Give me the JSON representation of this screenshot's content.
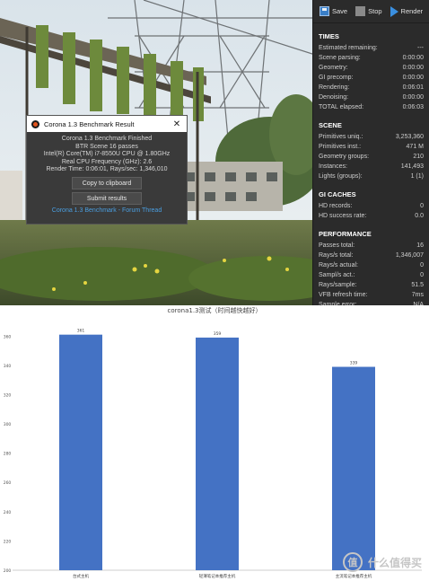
{
  "dialog": {
    "title": "Corona 1.3 Benchmark Result",
    "close_glyph": "✕",
    "lines": [
      "Corona 1.3 Benchmark Finished",
      "BTR Scene 16 passes",
      "Intel(R) Core(TM) i7-8550U CPU @ 1.80GHz",
      "Real CPU Frequency (GHz): 2.6",
      "Render Time: 0:06:01, Rays/sec: 1,346,010"
    ],
    "copy_button": "Copy to clipboard",
    "submit_button": "Submit results",
    "link": "Corona 1.3 Benchmark - Forum Thread"
  },
  "panel": {
    "toolbar": {
      "save": "Save",
      "stop": "Stop",
      "render": "Render"
    },
    "sections": [
      {
        "title": "TIMES",
        "rows": [
          [
            "Estimated remaining:",
            "---"
          ],
          [
            "Scene parsing:",
            "0:00:00"
          ],
          [
            "Geometry:",
            "0:00:00"
          ],
          [
            "GI precomp:",
            "0:00:00"
          ],
          [
            "Rendering:",
            "0:06:01"
          ],
          [
            "Denoising:",
            "0:00:00"
          ],
          [
            "TOTAL elapsed:",
            "0:06:03"
          ]
        ]
      },
      {
        "title": "SCENE",
        "rows": [
          [
            "Primitives uniq.:",
            "3,253,360"
          ],
          [
            "Primitives inst.:",
            "471 M"
          ],
          [
            "Geometry groups:",
            "210"
          ],
          [
            "Instances:",
            "141,493"
          ],
          [
            "Lights (groups):",
            "1 (1)"
          ]
        ]
      },
      {
        "title": "GI CACHES",
        "rows": [
          [
            "HD records:",
            "0"
          ],
          [
            "HD success rate:",
            "0.0"
          ]
        ]
      },
      {
        "title": "PERFORMANCE",
        "rows": [
          [
            "Passes total:",
            "16"
          ],
          [
            "Rays/s total:",
            "1,346,007"
          ],
          [
            "Rays/s actual:",
            "0"
          ],
          [
            "Sampl/s act.:",
            "0"
          ],
          [
            "Rays/sample:",
            "51.5"
          ],
          [
            "VFB refresh time:",
            "7ms"
          ],
          [
            "Sample error:",
            "N/A"
          ]
        ]
      }
    ]
  },
  "chart_data": {
    "type": "bar",
    "title": "corona1.3测试（时间越快越好）",
    "categories": [
      "台式主机",
      "轻薄笔记本推荐主机",
      "主流笔记本推荐主机"
    ],
    "values": [
      361,
      359,
      339
    ],
    "ylim": [
      200,
      370
    ],
    "yticks": [
      200,
      220,
      240,
      260,
      280,
      300,
      320,
      340,
      360
    ],
    "bar_color": "#4472c4",
    "grid": false
  },
  "watermark": {
    "text": "什么值得买",
    "icon_glyph": "值"
  }
}
